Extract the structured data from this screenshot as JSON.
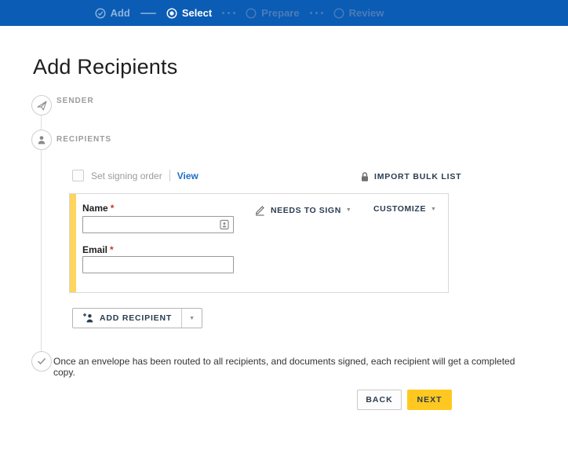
{
  "stepper": {
    "steps": [
      {
        "label": "Add",
        "state": "done"
      },
      {
        "label": "Select",
        "state": "active"
      },
      {
        "label": "Prepare",
        "state": "todo"
      },
      {
        "label": "Review",
        "state": "todo"
      }
    ]
  },
  "page": {
    "title": "Add Recipients"
  },
  "sender": {
    "label": "SENDER"
  },
  "recipients": {
    "label": "RECIPIENTS",
    "signing_order_label": "Set signing order",
    "view_link": "View",
    "import_bulk_list": "IMPORT BULK LIST",
    "card": {
      "name_label": "Name",
      "email_label": "Email",
      "required_mark": "*",
      "name_value": "",
      "email_value": "",
      "role_dropdown": "NEEDS TO SIGN",
      "customize_dropdown": "CUSTOMIZE"
    },
    "add_recipient_button": "ADD RECIPIENT"
  },
  "footer": {
    "note": "Once an envelope has been routed to all recipients, and documents signed, each recipient will get a completed copy.",
    "back_button": "BACK",
    "next_button": "NEXT"
  },
  "colors": {
    "topbar_blue": "#0b5cb4",
    "accent_yellow": "#ffc820",
    "card_stripe_yellow": "#ffd45f",
    "link_blue": "#1e6fc5",
    "dark_label": "#2b3c50",
    "required_red": "#c9352e"
  }
}
